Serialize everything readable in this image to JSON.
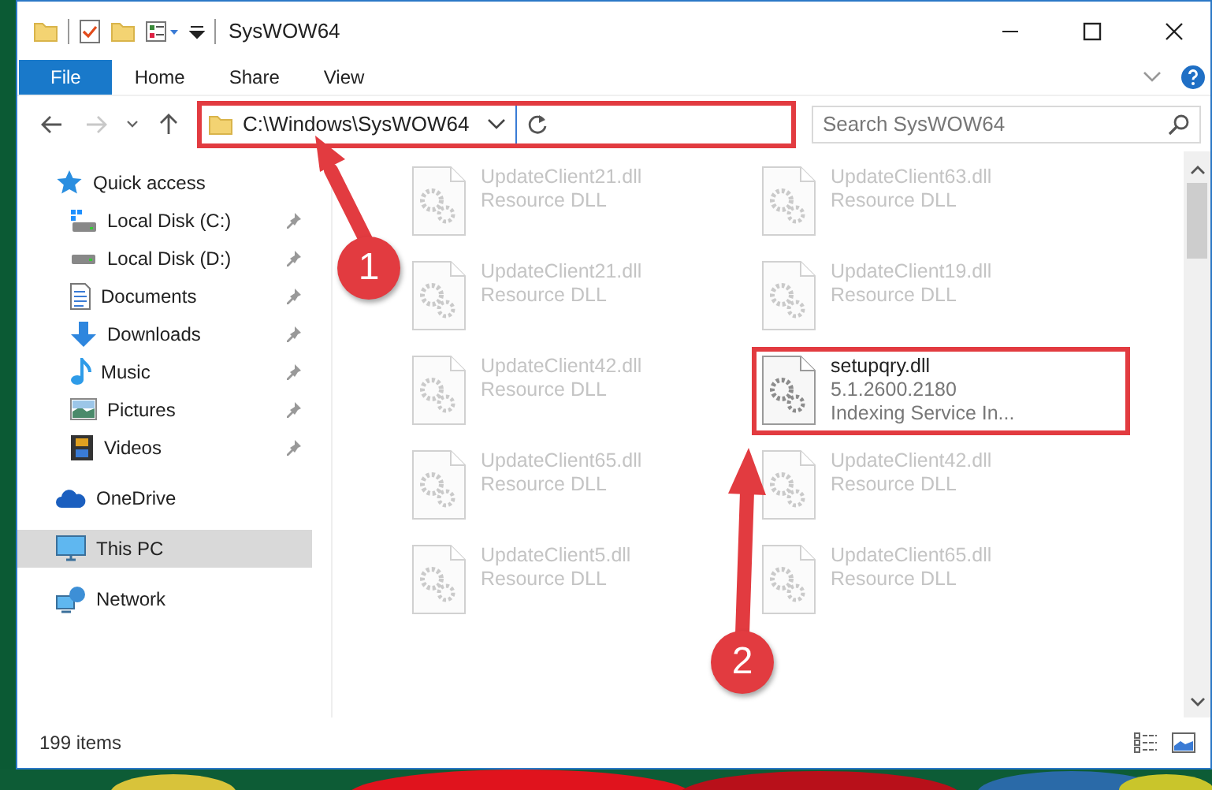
{
  "window": {
    "title": "SysWOW64"
  },
  "ribbon_tabs": [
    {
      "label": "File",
      "kind": "file"
    },
    {
      "label": "Home",
      "kind": "tab"
    },
    {
      "label": "Share",
      "kind": "tab"
    },
    {
      "label": "View",
      "kind": "tab"
    }
  ],
  "address_bar": {
    "path": "C:\\Windows\\SysWOW64",
    "highlighted": true
  },
  "search": {
    "placeholder": "Search SysWOW64"
  },
  "sidebar": {
    "items": [
      {
        "label": "Quick access",
        "selected": false,
        "children": [
          {
            "label": "Local Disk (C:)",
            "pinned": true,
            "selected": false
          },
          {
            "label": "Local Disk (D:)",
            "pinned": true,
            "selected": false
          },
          {
            "label": "Documents",
            "pinned": true,
            "selected": false
          },
          {
            "label": "Downloads",
            "pinned": true,
            "selected": false
          },
          {
            "label": "Music",
            "pinned": true,
            "selected": false
          },
          {
            "label": "Pictures",
            "pinned": true,
            "selected": false
          },
          {
            "label": "Videos",
            "pinned": true,
            "selected": false
          }
        ]
      },
      {
        "label": "OneDrive",
        "selected": false
      },
      {
        "label": "This PC",
        "selected": true
      },
      {
        "label": "Network",
        "selected": false
      }
    ]
  },
  "files": [
    {
      "name": "UpdateClient21.dll",
      "details": [
        "Resource DLL"
      ],
      "blurred": true,
      "highlighted": false
    },
    {
      "name": "UpdateClient63.dll",
      "details": [
        "Resource DLL"
      ],
      "blurred": true,
      "highlighted": false
    },
    {
      "name": "UpdateClient21.dll",
      "details": [
        "Resource DLL"
      ],
      "blurred": true,
      "highlighted": false
    },
    {
      "name": "UpdateClient19.dll",
      "details": [
        "Resource DLL"
      ],
      "blurred": true,
      "highlighted": false
    },
    {
      "name": "UpdateClient42.dll",
      "details": [
        "Resource DLL"
      ],
      "blurred": true,
      "highlighted": false
    },
    {
      "name": "setupqry.dll",
      "details": [
        "5.1.2600.2180",
        "Indexing Service In..."
      ],
      "blurred": false,
      "highlighted": true
    },
    {
      "name": "UpdateClient65.dll",
      "details": [
        "Resource DLL"
      ],
      "blurred": true,
      "highlighted": false
    },
    {
      "name": "UpdateClient42.dll",
      "details": [
        "Resource DLL"
      ],
      "blurred": true,
      "highlighted": false
    },
    {
      "name": "UpdateClient5.dll",
      "details": [
        "Resource DLL"
      ],
      "blurred": true,
      "highlighted": false
    },
    {
      "name": "UpdateClient65.dll",
      "details": [
        "Resource DLL"
      ],
      "blurred": true,
      "highlighted": false
    }
  ],
  "status_bar": {
    "item_count": "199 items"
  },
  "callouts": [
    {
      "label": "1"
    },
    {
      "label": "2"
    }
  ]
}
